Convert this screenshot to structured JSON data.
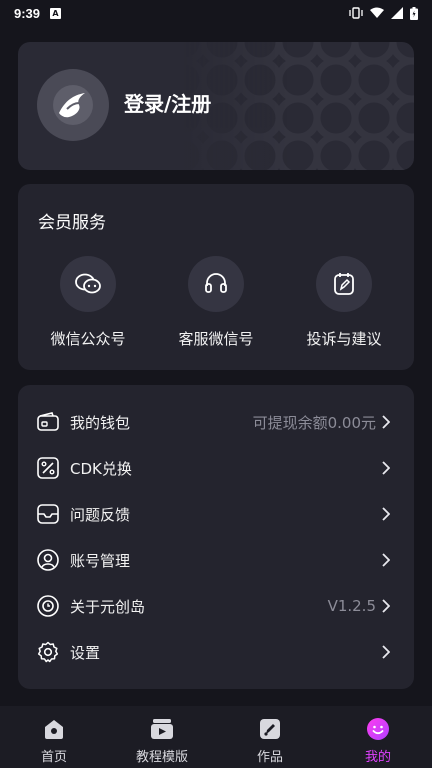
{
  "status_bar": {
    "time": "9:39",
    "notif_letter": "A"
  },
  "login": {
    "label": "登录/注册"
  },
  "services": {
    "title": "会员服务",
    "items": [
      {
        "label": "微信公众号",
        "icon": "wechat-icon"
      },
      {
        "label": "客服微信号",
        "icon": "headset-icon"
      },
      {
        "label": "投诉与建议",
        "icon": "feedback-edit-icon"
      }
    ]
  },
  "menu": {
    "items": [
      {
        "label": "我的钱包",
        "value": "可提现余额0.00元",
        "icon": "wallet-icon"
      },
      {
        "label": "CDK兑换",
        "value": "",
        "icon": "percent-coupon-icon"
      },
      {
        "label": "问题反馈",
        "value": "",
        "icon": "inbox-icon"
      },
      {
        "label": "账号管理",
        "value": "",
        "icon": "user-icon"
      },
      {
        "label": "关于元创岛",
        "value": "V1.2.5",
        "icon": "clock-info-icon"
      },
      {
        "label": "设置",
        "value": "",
        "icon": "gear-icon"
      }
    ]
  },
  "nav": {
    "items": [
      {
        "label": "首页",
        "icon": "home-icon"
      },
      {
        "label": "教程模版",
        "icon": "video-template-icon"
      },
      {
        "label": "作品",
        "icon": "works-icon"
      },
      {
        "label": "我的",
        "icon": "profile-smile-icon"
      }
    ],
    "active_index": 3,
    "active_color": "#e040ff"
  },
  "colors": {
    "background": "#15151c",
    "card": "#24242e",
    "accent": "#e040ff"
  }
}
